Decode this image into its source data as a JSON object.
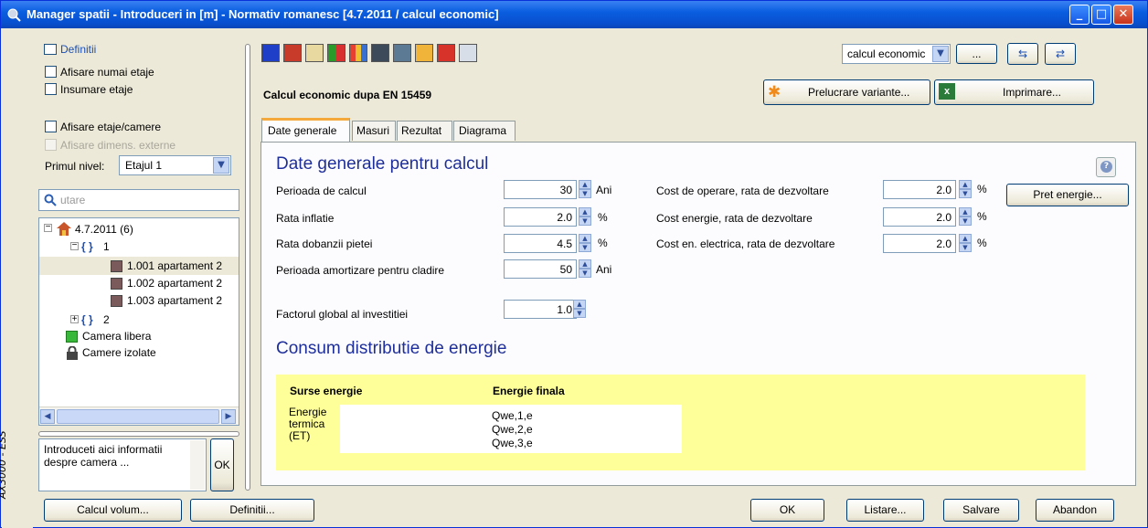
{
  "window": {
    "title": "Manager spatii - Introduceri in [m] - Normativ romanesc [4.7.2011 / calcul economic]",
    "side_label": "AX3000 - ESS"
  },
  "left": {
    "definitii_label": "Definitii",
    "afisare_numai_etaje": "Afisare numai etaje",
    "insumare_etaje": "Insumare etaje",
    "afisare_etaje_camere": "Afisare etaje/camere",
    "afisare_dimens_externe": "Afisare dimens. externe",
    "primul_nivel_label": "Primul nivel:",
    "primul_nivel_value": "Etajul 1",
    "search_placeholder": "utare",
    "tree": {
      "root": "4.7.2011 (6)",
      "group1": "1",
      "rooms": [
        "1.001 apartament 2",
        "1.002 apartament 2",
        "1.003 apartament 2"
      ],
      "group2": "2",
      "camera_libera": "Camera libera",
      "camere_izolate": "Camere izolate"
    },
    "info_text": "Introduceti aici informatii despre camera ...",
    "ok_label": "OK"
  },
  "top": {
    "section_title": "Calcul economic dupa EN 15459",
    "variant_value": "calcul economic",
    "dots_label": "...",
    "prelucrare_label": "Prelucrare variante...",
    "imprimare_label": "Imprimare..."
  },
  "tabs": [
    "Date generale",
    "Masuri",
    "Rezultat",
    "Diagrama"
  ],
  "general": {
    "heading": "Date generale pentru calcul",
    "left_rows": [
      {
        "label": "Perioada de calcul",
        "value": "30",
        "unit": "Ani"
      },
      {
        "label": "Rata inflatie",
        "value": "2.0",
        "unit": "%"
      },
      {
        "label": "Rata dobanzii pietei",
        "value": "4.5",
        "unit": "%"
      },
      {
        "label": "Perioada amortizare pentru cladire",
        "value": "50",
        "unit": "Ani"
      }
    ],
    "factor_label": "Factorul global al investitiei",
    "factor_value": "1.0",
    "right_rows": [
      {
        "label": "Cost de operare, rata de dezvoltare",
        "value": "2.0",
        "unit": "%"
      },
      {
        "label": "Cost energie, rata de dezvoltare",
        "value": "2.0",
        "unit": "%"
      },
      {
        "label": "Cost en. electrica, rata de dezvoltare",
        "value": "2.0",
        "unit": "%"
      }
    ],
    "pret_energie_label": "Pret energie..."
  },
  "consum": {
    "heading": "Consum distributie de energie",
    "col1": "Surse energie",
    "col2": "Energie finala",
    "source": "Energie termica (ET)",
    "values": [
      "Qwe,1,e",
      "Qwe,2,e",
      "Qwe,3,e"
    ]
  },
  "bottom": {
    "calcul_volum": "Calcul volum...",
    "definitii": "Definitii...",
    "ok": "OK",
    "listare": "Listare...",
    "salvare": "Salvare",
    "abandon": "Abandon"
  },
  "colors": {
    "titlebar": "#0a5ee0",
    "heading": "#1f2f9a",
    "yellow_panel": "#ffff99"
  }
}
